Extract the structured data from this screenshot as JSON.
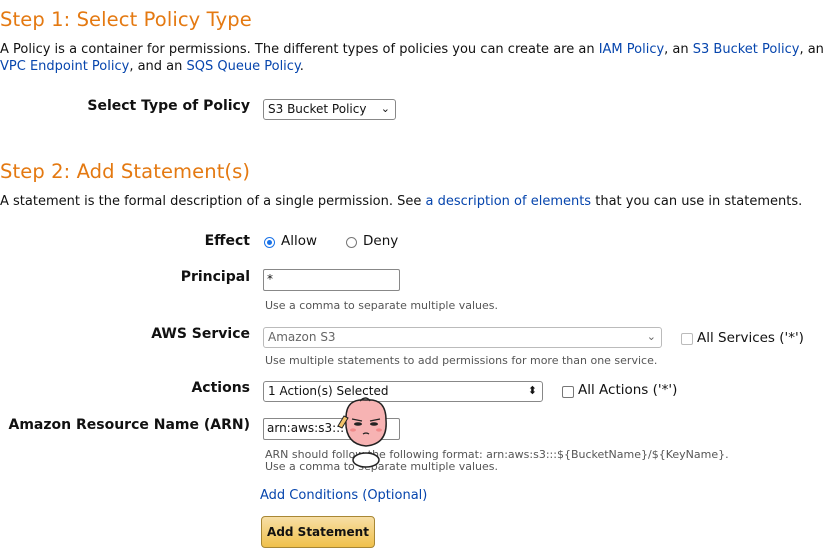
{
  "step1": {
    "heading": "Step 1: Select Policy Type",
    "desc_start": "A Policy is a container for permissions. The different types of policies you can create are an ",
    "link_iam": "IAM Policy",
    "sep1": ", an ",
    "link_s3": "S3 Bucket Policy",
    "tail1": ", an",
    "link_vpc": "VPC Endpoint Policy",
    "sep2": ", and an ",
    "link_sqs": "SQS Queue Policy",
    "end": ".",
    "type_label": "Select Type of Policy",
    "type_value": "S3 Bucket Policy"
  },
  "step2": {
    "heading": "Step 2: Add Statement(s)",
    "desc_start": "A statement is the formal description of a single permission. See ",
    "desc_link": "a description of elements",
    "desc_end": " that you can use in statements.",
    "effect_label": "Effect",
    "effect_allow": "Allow",
    "effect_deny": "Deny",
    "effect_selected": "Allow",
    "principal_label": "Principal",
    "principal_value": "*",
    "principal_hint": "Use a comma to separate multiple values.",
    "service_label": "AWS Service",
    "service_value": "Amazon S3",
    "service_all": "All Services ('*')",
    "service_hint": "Use multiple statements to add permissions for more than one service.",
    "actions_label": "Actions",
    "actions_value": "1 Action(s) Selected",
    "actions_all": "All Actions ('*')",
    "arn_label": "Amazon Resource Name (ARN)",
    "arn_value": "arn:aws:s3:::",
    "arn_hint1": "ARN should follow the following format: arn:aws:s3:::${BucketName}/${KeyName}.",
    "arn_hint2": "Use a comma to separate multiple values.",
    "conditions_link": "Add Conditions (Optional)",
    "add_button": "Add Statement"
  },
  "colors": {
    "heading": "#e47911",
    "link": "#0645ad",
    "button": "#f0c14b"
  },
  "overlay": {
    "sticker": "peach-character-sticker"
  }
}
